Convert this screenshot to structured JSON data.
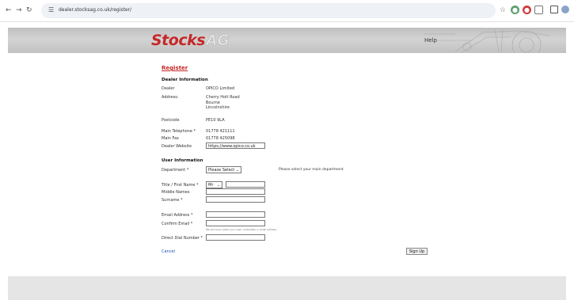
{
  "browser": {
    "url": "dealer.stocksag.co.uk/register/"
  },
  "header": {
    "logo_main": "Stocks",
    "logo_suffix": "AG",
    "help_label": "Help"
  },
  "form": {
    "title": "Register",
    "dealer_section": {
      "heading": "Dealer Information",
      "dealer_label": "Dealer",
      "dealer_value": "OPICO Limited",
      "address_label": "Address:",
      "address_lines": [
        "Cherry Holt Road",
        "Bourne",
        "Lincolnshire"
      ],
      "postcode_label": "Postcode",
      "postcode_value": "PE10 9LA",
      "telephone_label": "Main Telephone *",
      "telephone_value": "01778 421111",
      "fax_label": "Main Fax",
      "fax_value": "01778 425098",
      "website_label": "Dealer Website",
      "website_value": "https://www.opico.co.uk"
    },
    "user_section": {
      "heading": "User Information",
      "department_label": "Department *",
      "department_value": "Please Select",
      "department_note": "Please select your main department",
      "title_label": "Title / First Name *",
      "title_value": "Mr",
      "first_name_value": "",
      "middle_label": "Middle Names",
      "surname_label": "Surname *",
      "email_label": "Email Address *",
      "confirm_email_label": "Confirm Email *",
      "email_hint": "We will never share your login credentials or email address.",
      "dial_label": "Direct Dial Number *"
    },
    "cancel_label": "Cancel",
    "signup_label": "Sign Up"
  },
  "colors": {
    "brand_red": "#c62828",
    "link_blue": "#1a4fb5"
  }
}
